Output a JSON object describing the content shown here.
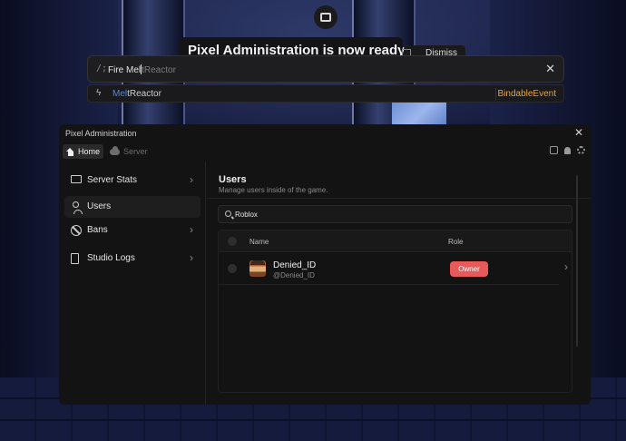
{
  "notification": {
    "title": "Pixel Administration is now ready!",
    "dismiss_label": "Dismiss"
  },
  "command_bar": {
    "prefix": "/;",
    "typed": "Fire Mel",
    "ghost": "tReactor",
    "close_glyph": "✕"
  },
  "suggestion": {
    "match": "Mel",
    "rest": "tReactor",
    "type": "BindableEvent"
  },
  "window": {
    "title": "Pixel Administration",
    "close_glyph": "✕",
    "tabs": [
      {
        "label": "Home",
        "icon": "home-icon",
        "active": true
      },
      {
        "label": "Server",
        "icon": "cloud-icon",
        "active": false
      }
    ],
    "toolbar_icons": [
      "chat-icon",
      "bell-icon",
      "gear-icon"
    ]
  },
  "sidebar": {
    "items": [
      {
        "label": "Server Stats",
        "icon": "monitor-icon",
        "active": false
      },
      {
        "label": "Users",
        "icon": "users-icon",
        "active": true
      },
      {
        "label": "Bans",
        "icon": "ban-icon",
        "active": false
      },
      {
        "label": "Studio Logs",
        "icon": "logs-icon",
        "active": false
      }
    ],
    "chevron": "›"
  },
  "content": {
    "title": "Users",
    "subtitle": "Manage users inside of the game.",
    "search_value": "Roblox",
    "columns": {
      "name": "Name",
      "role": "Role"
    },
    "rows": [
      {
        "display_name": "Denied_ID",
        "handle": "@Denied_ID",
        "role": "Owner",
        "role_color": "#e85a5a"
      }
    ],
    "row_chevron": "›"
  },
  "colors": {
    "accent_orange": "#e8a23a",
    "match_blue": "#4a8ae6",
    "owner_red": "#e85a5a"
  }
}
